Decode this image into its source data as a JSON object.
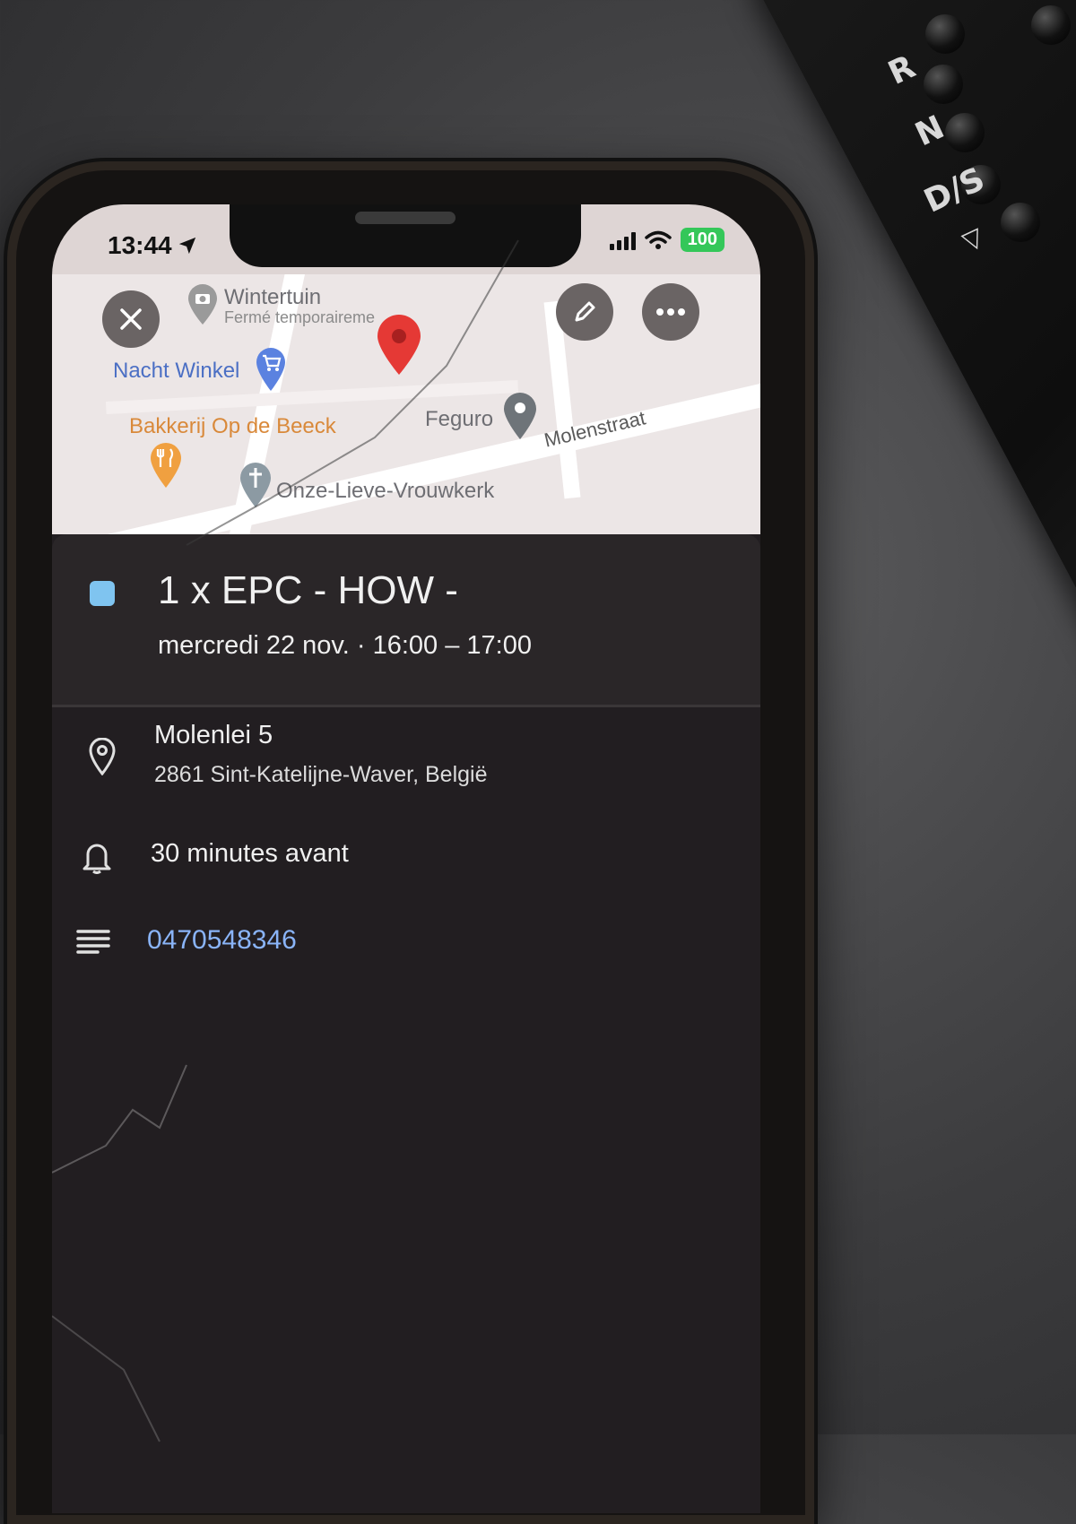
{
  "status_bar": {
    "time": "13:44",
    "battery": "100"
  },
  "map": {
    "pois": {
      "wintertuin": "Wintertuin",
      "wintertuin_sub": "Fermé temporaireme",
      "nacht_winkel": "Nacht Winkel",
      "bakkerij": "Bakkerij Op de Beeck",
      "feguro": "Feguro",
      "molenstraat": "Molenstraat",
      "kerk": "Onze-Lieve-Vrouwkerk"
    }
  },
  "event": {
    "title": "1 x EPC - HOW -",
    "when": "mercredi 22 nov. · 16:00 – 17:00",
    "color": "#7fc4f0",
    "location_title": "Molenlei 5",
    "location_sub": "2861 Sint-Katelijne-Waver, België",
    "reminder": "30 minutes avant",
    "description": "0470548346"
  },
  "console": {
    "gears": [
      "R",
      "N",
      "D/S",
      "▽"
    ]
  }
}
